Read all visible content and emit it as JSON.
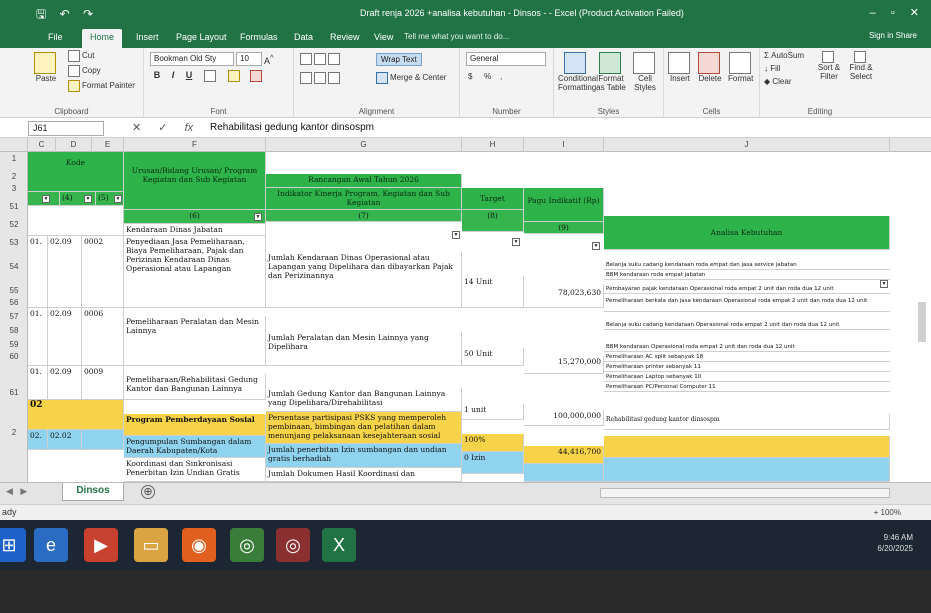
{
  "window": {
    "title": "Draft renja 2026 +analisa kebutuhan - Dinsos - - Excel (Product Activation Failed)",
    "controls": [
      "–",
      "▫",
      "✕"
    ]
  },
  "qat": {
    "save": "🖫",
    "undo": "↶",
    "redo": "↷"
  },
  "ribbon_tabs": [
    "File",
    "Home",
    "Insert",
    "Page Layout",
    "Formulas",
    "Data",
    "Review",
    "View"
  ],
  "tell_me": "Tell me what you want to do...",
  "sign_in": "Sign in   Share",
  "clipboard": {
    "paste": "Paste",
    "cut": "Cut",
    "copy": "Copy",
    "format_painter": "Format Painter",
    "label": "Clipboard"
  },
  "font": {
    "name": "Bookman Old Sty",
    "size": "10",
    "bold": "B",
    "italic": "I",
    "underline": "U",
    "label": "Font"
  },
  "alignment": {
    "wrap_text": "Wrap Text",
    "merge_center": "Merge & Center",
    "label": "Alignment"
  },
  "number": {
    "format": "General",
    "currency": "$",
    "percent": "%",
    "comma": ",",
    "label": "Number"
  },
  "styles": {
    "conditional": "Conditional Formatting",
    "format_table": "Format as Table",
    "cell_styles": "Cell Styles",
    "label": "Styles"
  },
  "cells": {
    "insert": "Insert",
    "delete": "Delete",
    "format": "Format",
    "label": "Cells"
  },
  "editing": {
    "autosum": "AutoSum",
    "fill": "Fill",
    "clear": "Clear",
    "sort": "Sort & Filter",
    "find": "Find & Select",
    "label": "Editing"
  },
  "formula_bar": {
    "name_box": "J61",
    "cancel": "✕",
    "enter": "✓",
    "fx": "fx",
    "content": "Rehabilitasi gedung kantor dinsospm"
  },
  "columns": [
    "C",
    "D",
    "E",
    "F",
    "G",
    "H",
    "I",
    "J"
  ],
  "rows": [
    "1",
    "2",
    "3",
    "51",
    "52",
    "53",
    "54",
    "55",
    "56",
    "57",
    "58",
    "59",
    "60",
    "61",
    "2"
  ],
  "headers": {
    "kode": "Kode",
    "urusan": "Urusan/Bidang Urusan/ Program Kegiatan dan Sub Kegiatan",
    "rancangan": "Rancangan Awal Tahun 2026",
    "indikator": "Indikator Kinerja Program, Kegiatan dan Sub Kegiatan",
    "target": "Target",
    "pagu": "Pagu Indikatif (Rp)",
    "analisa": "Analisa Kebutuhan",
    "n4": "(4)",
    "n5": "(5)",
    "n6": "(6)",
    "n7": "(7)",
    "n8": "(8)",
    "n9": "(9)"
  },
  "table_rows": [
    {
      "c": "",
      "d": "",
      "e": "",
      "f": "Kendaraan Dinas Jabatan",
      "g": "",
      "h": "",
      "i": ""
    },
    {
      "c": "01.",
      "d": "02.09",
      "e": "0002",
      "f": "Penyediaan Jasa Pemeliharaan, Biaya Pemeliharaan, Pajak dan Perizinan Kendaraan Dinas Operasional atau Lapangan",
      "g": "Jumlah Kendaraan Dinas Operasional atau Lapangan yang Dipelihara dan dibayarkan Pajak dan Perizinannya",
      "h": "14 Unit",
      "i": "78,023,630"
    },
    {
      "c": "01.",
      "d": "02.09",
      "e": "0006",
      "f": "Pemeliharaan Peralatan dan Mesin Lainnya",
      "g": "Jumlah Peralatan dan Mesin Lainnya yang Dipelihara",
      "h": "50 Unit",
      "i": "15,270,000"
    },
    {
      "c": "01.",
      "d": "02.09",
      "e": "0009",
      "f": "Pemeliharaan/Rehabilitasi Gedung Kantor dan Bangunan Lainnya",
      "g": "Jumlah Gedung Kantor dan Bangunan Lainnya yang Dipelihara/Direhabilitasi",
      "h": "1 unit",
      "i": "100,000,000",
      "j": "Rehabilitasi gedung kantor dinsospm"
    },
    {
      "c": "02",
      "d": "",
      "e": "",
      "f": "Program Pemberdayaan Sosial",
      "g": "Persentase partisipasi PSKS yang memperoleh pembinaan, bimbingan dan pelatihan dalam menunjang pelaksanaan kesejahteraan sosial",
      "h": "100%",
      "i": "44,416,700"
    },
    {
      "c": "02.",
      "d": "02.02",
      "e": "",
      "f": "Pengumpulan Sumbangan dalam Daerah Kabupaten/Kota",
      "g": "Jumlah penerbitan Izin sumbangan dan undian gratis berhadiah",
      "h": "0 Izin",
      "i": ""
    },
    {
      "c": "",
      "d": "",
      "e": "",
      "f": "Koordinasi dan Sinkronisasi Penerbitan Izin Undian Gratis",
      "g": "Jumlah Dokumen Hasil Koordinasi dan",
      "h": "",
      "i": ""
    }
  ],
  "analisa_notes": [
    "Belanja suku cadang kendaraan roda empat dan jasa service jabatan",
    "BBM kendaraan roda empat jabatan",
    "Pembayaran pajak kendaraan Operasional roda empat 2 unit dan roda dua 12 unit",
    "Pemeliharaan berkala dan jasa kendaraan Operasional roda empat 2 unit dan roda dua 12 unit",
    "Belanja suku cadang kendaraan Operasional roda empat 2 unit dan roda dua 12 unit",
    "BBM kendaraan Operasional roda empat 2 unit dan roda dua 12 unit",
    "Pemeliharaan AC split sebanyak 18",
    "Pemeliharaan printer sebanyak 11",
    "Pemeliharaan Laptop sebanyak 10",
    "Pemeliharaan PC/Personal Computer 11"
  ],
  "sheet_tab": "Dinsos",
  "add_sheet": "⊕",
  "status": "ady",
  "zoom": "+ 100%",
  "tray": {
    "time": "9:46 AM",
    "date": "6/20/2025"
  },
  "colors": {
    "excel_green": "#217346",
    "header_green": "#2db34a",
    "yellow_row": "#f7d34a",
    "cyan_row": "#8fd3ef",
    "taskbar": "#1c2733"
  }
}
